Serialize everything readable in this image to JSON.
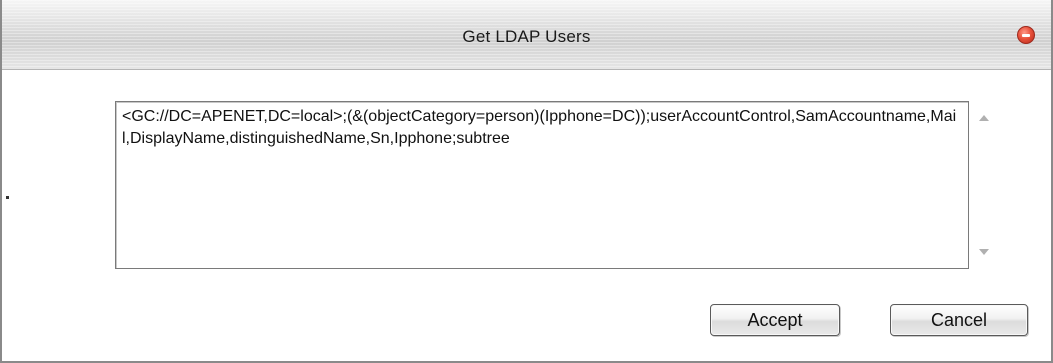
{
  "window": {
    "title": "Get LDAP Users"
  },
  "query_box": {
    "value": "<GC://DC=APENET,DC=local>;(&(objectCategory=person)(Ipphone=DC));userAccountControl,SamAccountname,Mail,DisplayName,distinguishedName,Sn,Ipphone;subtree"
  },
  "buttons": {
    "accept_label": "Accept",
    "cancel_label": "Cancel"
  },
  "colors": {
    "close_button": "#e8523c",
    "titlebar": "#dcdcdc"
  },
  "icons": {
    "close": "close-icon",
    "scroll_up": "scroll-up-arrow-icon",
    "scroll_down": "scroll-down-arrow-icon"
  }
}
